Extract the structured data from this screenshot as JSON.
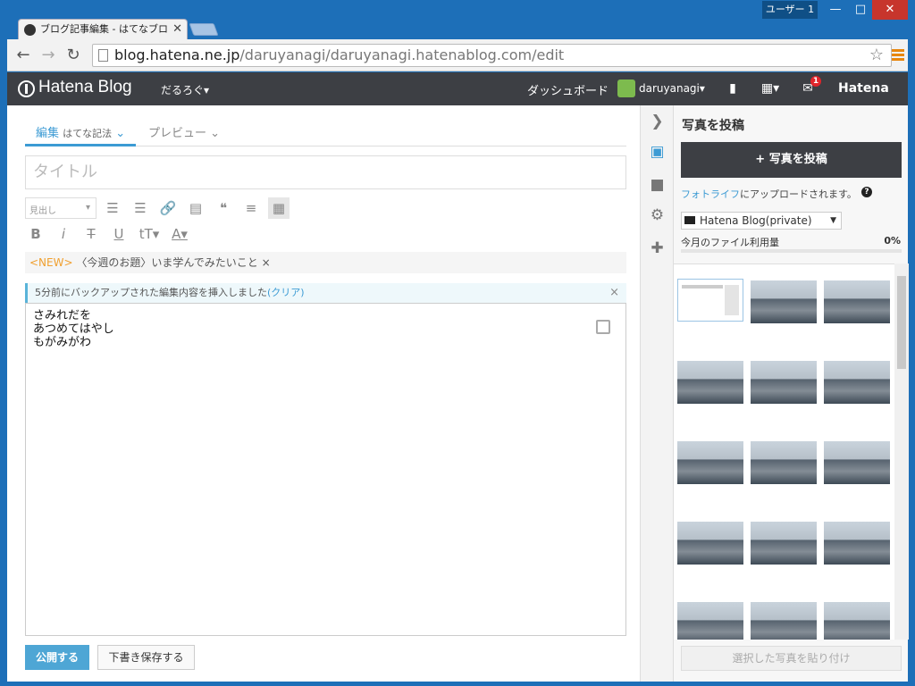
{
  "window": {
    "user_badge": "ユーザー 1"
  },
  "browser": {
    "tab_title": "ブログ記事編集 - はてなブロ",
    "url_host": "blog.hatena.ne.jp",
    "url_path": "/daruyanagi/daruyanagi.hatenablog.com/edit"
  },
  "header": {
    "logo": "Hatena Blog",
    "blog_name": "だるろぐ▾",
    "dashboard": "ダッシュボード",
    "username": "daruyanagi▾",
    "notification_count": "1",
    "hatena": "Hatena"
  },
  "editor": {
    "tab_edit": "編集",
    "tab_edit_mode": "はてな記法",
    "tab_preview": "プレビュー",
    "title_placeholder": "タイトル",
    "heading_select": "見出し",
    "topic_new": "<NEW>",
    "topic_text": "〈今週のお題〉いま学んでみたいこと",
    "backup_text": "5分前にバックアップされた編集内容を挿入しました",
    "backup_clear": "(クリア)",
    "body": "さみれだを\nあつめてはやし\nもがみがわ",
    "publish_button": "公開する",
    "draft_button": "下書き保存する"
  },
  "photo_panel": {
    "title": "写真を投稿",
    "post_button": "+ 写真を投稿",
    "fotolife_link": "フォトライフ",
    "fotolife_text": "にアップロードされます。",
    "blog_select": "Hatena Blog(private)",
    "usage_label": "今月のファイル利用量",
    "usage_value": "0%",
    "paste_button": "選択した写真を貼り付け"
  }
}
